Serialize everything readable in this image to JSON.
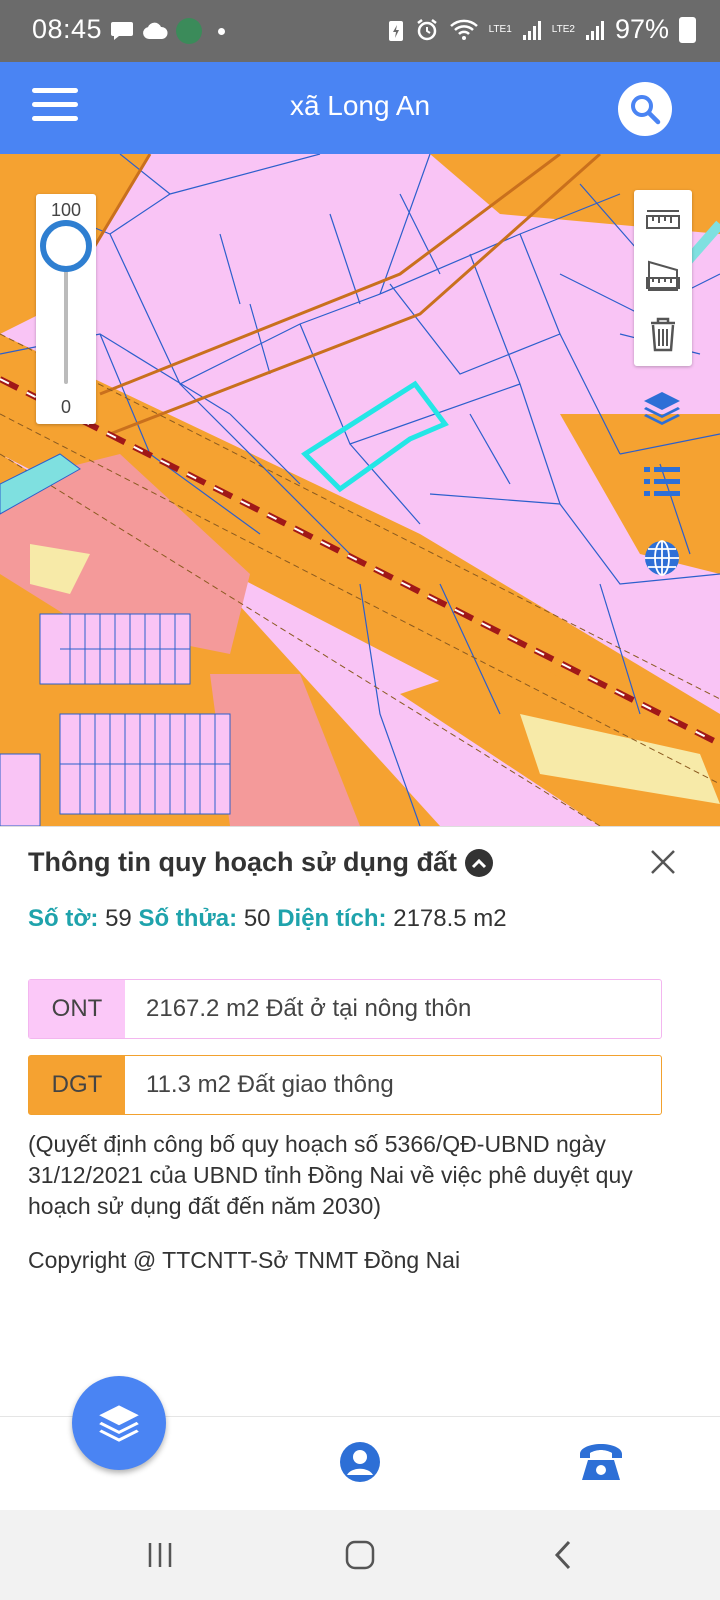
{
  "status_bar": {
    "time": "08:45",
    "battery_percent": "97%",
    "sim1_label": "LTE1",
    "sim2_label": "LTE2",
    "icons": [
      "chat-icon",
      "cloud-icon",
      "app-avatar",
      "notification-dot",
      "battery-saver-icon",
      "alarm-icon",
      "wifi-icon",
      "signal-icon",
      "battery-icon"
    ]
  },
  "header": {
    "title": "xã Long An",
    "menu_icon": "hamburger-menu-icon",
    "search_icon": "search-icon",
    "color": "#4a84f3"
  },
  "map": {
    "opacity_slider": {
      "max_label": "100",
      "min_label": "0",
      "value": 100
    },
    "tools": [
      "ruler-icon",
      "area-measure-icon",
      "trash-icon"
    ],
    "side_icons": [
      "layers-icon",
      "legend-list-icon",
      "globe-icon"
    ],
    "colors": {
      "residential": "#f9c4f5",
      "transport": "#f5a231",
      "commercial": "#f59a9a",
      "selected_parcel": "#24e6e6",
      "parcel_lines": "#2c5fcc"
    }
  },
  "info_panel": {
    "title": "Thông tin quy hoạch sử dụng đất",
    "sheet_label": "Số tờ:",
    "sheet_value": "59",
    "parcel_label": "Số thửa:",
    "parcel_value": "50",
    "area_label": "Diện tích:",
    "area_value": "2178.5 m2",
    "land_uses": [
      {
        "code": "ONT",
        "description": "2167.2 m2 Đất ở tại nông thôn",
        "color": "#fbc8f8"
      },
      {
        "code": "DGT",
        "description": "11.3 m2 Đất giao thông",
        "color": "#f5a231"
      }
    ],
    "decision_text": "(Quyết định công bố quy hoạch số 5366/QĐ-UBND ngày 31/12/2021 của UBND tỉnh Đồng Nai về việc phê duyệt quy hoạch sử dụng đất đến năm 2030)",
    "copyright": "Copyright @ TTCNTT-Sở TNMT Đồng Nai"
  },
  "bottom_nav": {
    "fab_icon": "layers-icon",
    "items": [
      "profile-icon",
      "phone-icon"
    ]
  },
  "system_nav": [
    "recents-icon",
    "home-icon",
    "back-icon"
  ]
}
